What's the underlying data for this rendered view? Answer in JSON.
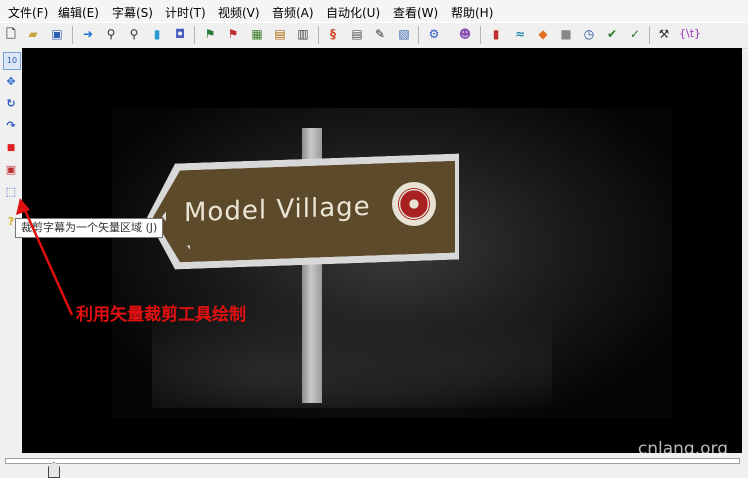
{
  "menu": [
    "文件(F)",
    "编辑(E)",
    "字幕(S)",
    "计时(T)",
    "视频(V)",
    "音频(A)",
    "自动化(U)",
    "查看(W)",
    "帮助(H)"
  ],
  "toolbar_icons": [
    "new-file-icon",
    "open-folder-icon",
    "save-icon",
    "jump-to-icon",
    "zoom-in-icon",
    "zoom-out-icon",
    "bottle-icon",
    "jar-icon",
    "flag-icon",
    "flag-red-icon",
    "grid-select-icon",
    "film-strip-icon",
    "film-grid-icon",
    "script-icon",
    "properties-icon",
    "pencil-icon",
    "styles-icon",
    "automation-icon",
    "avatar-icon",
    "audio-tool-icon",
    "splash-icon",
    "fish-icon",
    "stop-icon",
    "clock-icon",
    "spell-check-icon",
    "check-icon",
    "tools-icon",
    "karaoke-tag-icon"
  ],
  "toolbar_glyphs": {
    "karaoke_tag": "{\\t}"
  },
  "left_tools": [
    "standard-tool-icon",
    "drag-tool-icon",
    "rotate-z-icon",
    "rotate-xy-icon",
    "scale-icon",
    "rect-clip-icon",
    "vector-clip-icon",
    "help-icon"
  ],
  "left_tool_label_top": "10",
  "video": {
    "sign_text": "Model Village",
    "watermark": "cnlang.org"
  },
  "tooltip": "裁剪字幕为一个矢量区域 (J)",
  "annotation": "利用矢量裁剪工具绘制",
  "colors": {
    "annotation": "#e01010",
    "sign_bg": "#5c4a2a"
  }
}
